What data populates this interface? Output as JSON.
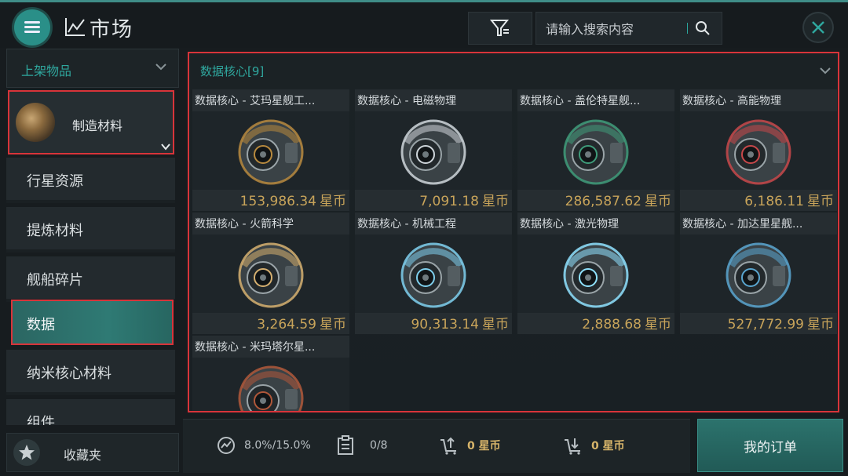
{
  "header": {
    "title": "市场",
    "search_placeholder": "请输入搜索内容"
  },
  "sidebar": {
    "dropdown_label": "上架物品",
    "selected_category": "制造材料",
    "items": [
      {
        "label": "行星资源"
      },
      {
        "label": "提炼材料"
      },
      {
        "label": "舰船碎片"
      },
      {
        "label": "数据"
      },
      {
        "label": "纳米核心材料"
      },
      {
        "label": "组件"
      }
    ],
    "favorites_label": "收藏夹"
  },
  "main": {
    "section_title": "数据核心[9]",
    "currency": "星币",
    "items": [
      {
        "name": "数据核心 - 艾玛星舰工...",
        "price": "153,986.34",
        "accent": "#b88a3e"
      },
      {
        "name": "数据核心 - 电磁物理",
        "price": "7,091.18",
        "accent": "#cfd6db"
      },
      {
        "name": "数据核心 - 盖伦特星舰...",
        "price": "286,587.62",
        "accent": "#3f9c7a"
      },
      {
        "name": "数据核心 - 高能物理",
        "price": "6,186.11",
        "accent": "#c8484a"
      },
      {
        "name": "数据核心 - 火箭科学",
        "price": "3,264.59",
        "accent": "#d6b070"
      },
      {
        "name": "数据核心 - 机械工程",
        "price": "90,313.14",
        "accent": "#7fd0ee"
      },
      {
        "name": "数据核心 - 激光物理",
        "price": "2,888.68",
        "accent": "#8fe2ff"
      },
      {
        "name": "数据核心 - 加达里星舰...",
        "price": "527,772.99",
        "accent": "#5aa6d0"
      },
      {
        "name": "数据核心 - 米玛塔尔星...",
        "price": "",
        "accent": "#b0583a"
      }
    ]
  },
  "bottom": {
    "tax": "8.0%/15.0%",
    "orders": "0/8",
    "sell_value": "0 星币",
    "buy_value": "0 星币",
    "my_orders": "我的订单"
  }
}
